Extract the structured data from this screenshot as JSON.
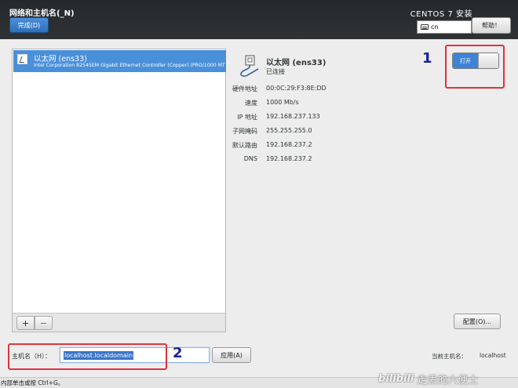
{
  "header": {
    "title": "网络和主机名(_N)",
    "done_label": "完成(D)",
    "product": "CENTOS 7 安装",
    "keyboard_layout": "cn",
    "help_label": "帮助！"
  },
  "devices": [
    {
      "name": "以太网 (ens33)",
      "description": "Intel Corporation 82545EM Gigabit Ethernet Controller (Copper) (PRO/1000 MT"
    }
  ],
  "list_toolbar": {
    "add": "+",
    "remove": "−"
  },
  "details": {
    "name": "以太网 (ens33)",
    "status": "已连接",
    "rows": [
      {
        "label": "硬件地址",
        "value": "00:0C:29:F3:8E:DD"
      },
      {
        "label": "速度",
        "value": "1000 Mb/s"
      },
      {
        "label": "IP 地址",
        "value": "192.168.237.133"
      },
      {
        "label": "子网掩码",
        "value": "255.255.255.0"
      },
      {
        "label": "默认路由",
        "value": "192.168.237.2"
      },
      {
        "label": "DNS",
        "value": "192.168.237.2"
      }
    ]
  },
  "toggle": {
    "label": "打开",
    "state": "on",
    "color": "#3f83d6"
  },
  "config_label": "配置(O)...",
  "hostname": {
    "label": "主机名（H）：",
    "value": "localhost.localdomain",
    "apply_label": "应用(A)",
    "current_label": "当前主机名：",
    "current_value": "localhost"
  },
  "annotations": {
    "one": "1",
    "two": "2",
    "color": "#e0323c"
  },
  "statusbar": "内部单击或按 Ctrl+G。",
  "watermark": {
    "logo": "bilibili",
    "text": "走丢的六便士"
  }
}
